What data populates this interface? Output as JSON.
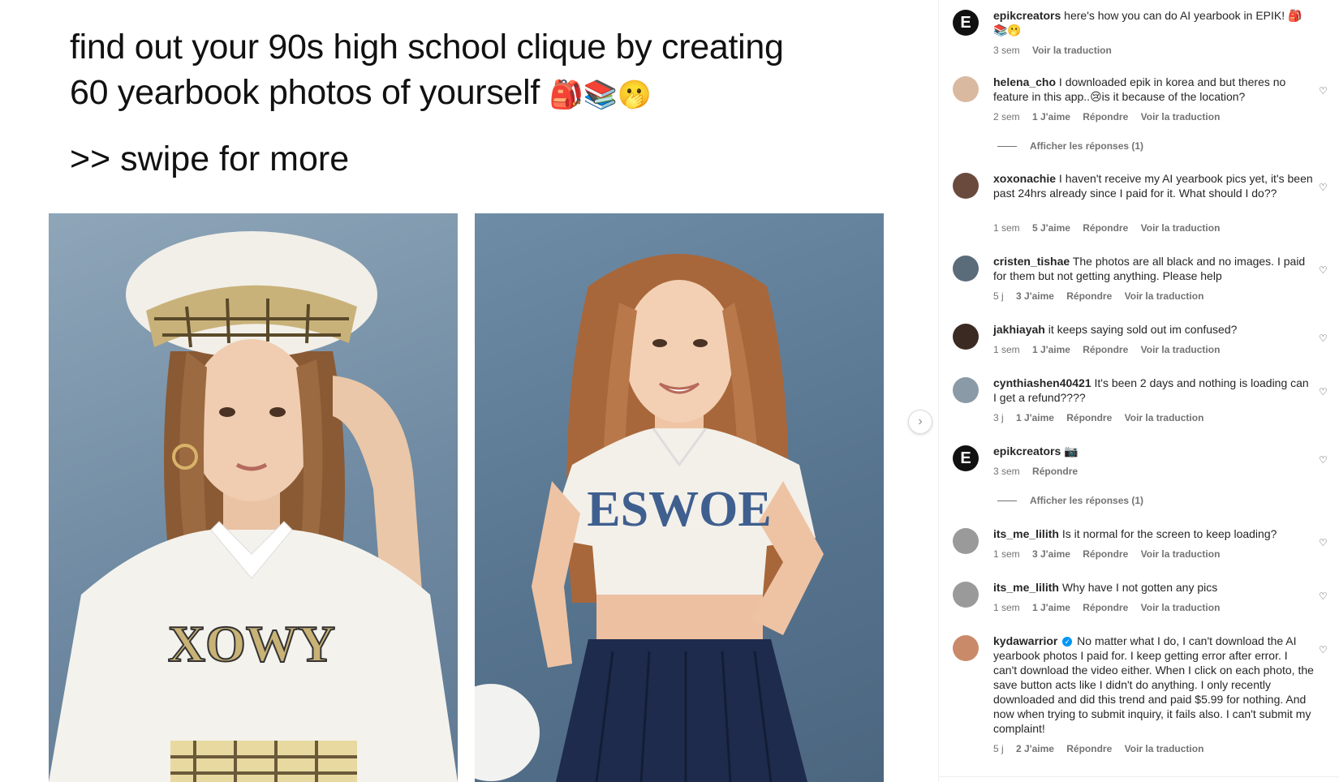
{
  "post": {
    "headline_line1": "find out your 90s high school clique by creating",
    "headline_line2": "60 yearbook photos of yourself",
    "headline_emoji": "🎒📚🫢",
    "swipe_text": ">> swipe for more",
    "photo1_shirt": "XOWY",
    "photo2_shirt": "ESWOE",
    "next_icon": "chevron-right-icon"
  },
  "caption": {
    "user": "epikcreators",
    "text": "here's how you can do AI yearbook in EPIK! 🎒📚🫢",
    "time": "3 sem",
    "translate": "Voir la traduction",
    "avatar_letter": "E"
  },
  "labels": {
    "reply": "Répondre",
    "translate": "Voir la traduction",
    "show_replies": "Afficher les réponses (1)"
  },
  "comments": [
    {
      "user": "helena_cho",
      "text": "I downloaded epik in korea and but theres no feature in this app..😢is it because of the location?",
      "time": "2 sem",
      "likes": "1 J'aime"
    },
    {
      "user": "xoxonachie",
      "text": "I haven't receive my AI yearbook pics yet, it's been past 24hrs already since I paid for it. What should I do??",
      "time": "1 sem",
      "likes": "5 J'aime"
    },
    {
      "user": "cristen_tishae",
      "text": "The photos are all black and no images. I paid for them but not getting anything. Please help",
      "time": "5 j",
      "likes": "3 J'aime"
    },
    {
      "user": "jakhiayah",
      "text": "it keeps saying sold out im confused?",
      "time": "1 sem",
      "likes": "1 J'aime"
    },
    {
      "user": "cynthiashen40421",
      "text": "It's been 2 days and nothing is loading can I get a refund????",
      "time": "3 j",
      "likes": "1 J'aime"
    },
    {
      "user": "epikcreators",
      "text": "📷",
      "time": "3 sem",
      "likes": ""
    },
    {
      "user": "its_me_lilith",
      "text": "Is it normal for the screen to keep loading?",
      "time": "1 sem",
      "likes": "3 J'aime"
    },
    {
      "user": "its_me_lilith",
      "text": "Why have I not gotten any pics",
      "time": "1 sem",
      "likes": "1 J'aime"
    },
    {
      "user": "kydawarrior",
      "text": "No matter what I do, I can't download the AI yearbook photos I paid for. I keep getting error after error. I can't download the video either. When I click on each photo, the save button acts like I didn't do anything. I only recently downloaded and did this trend and paid $5.99 for nothing. And now when trying to submit inquiry, it fails also. I can't submit my complaint!",
      "time": "5 j",
      "likes": "2 J'aime"
    }
  ]
}
